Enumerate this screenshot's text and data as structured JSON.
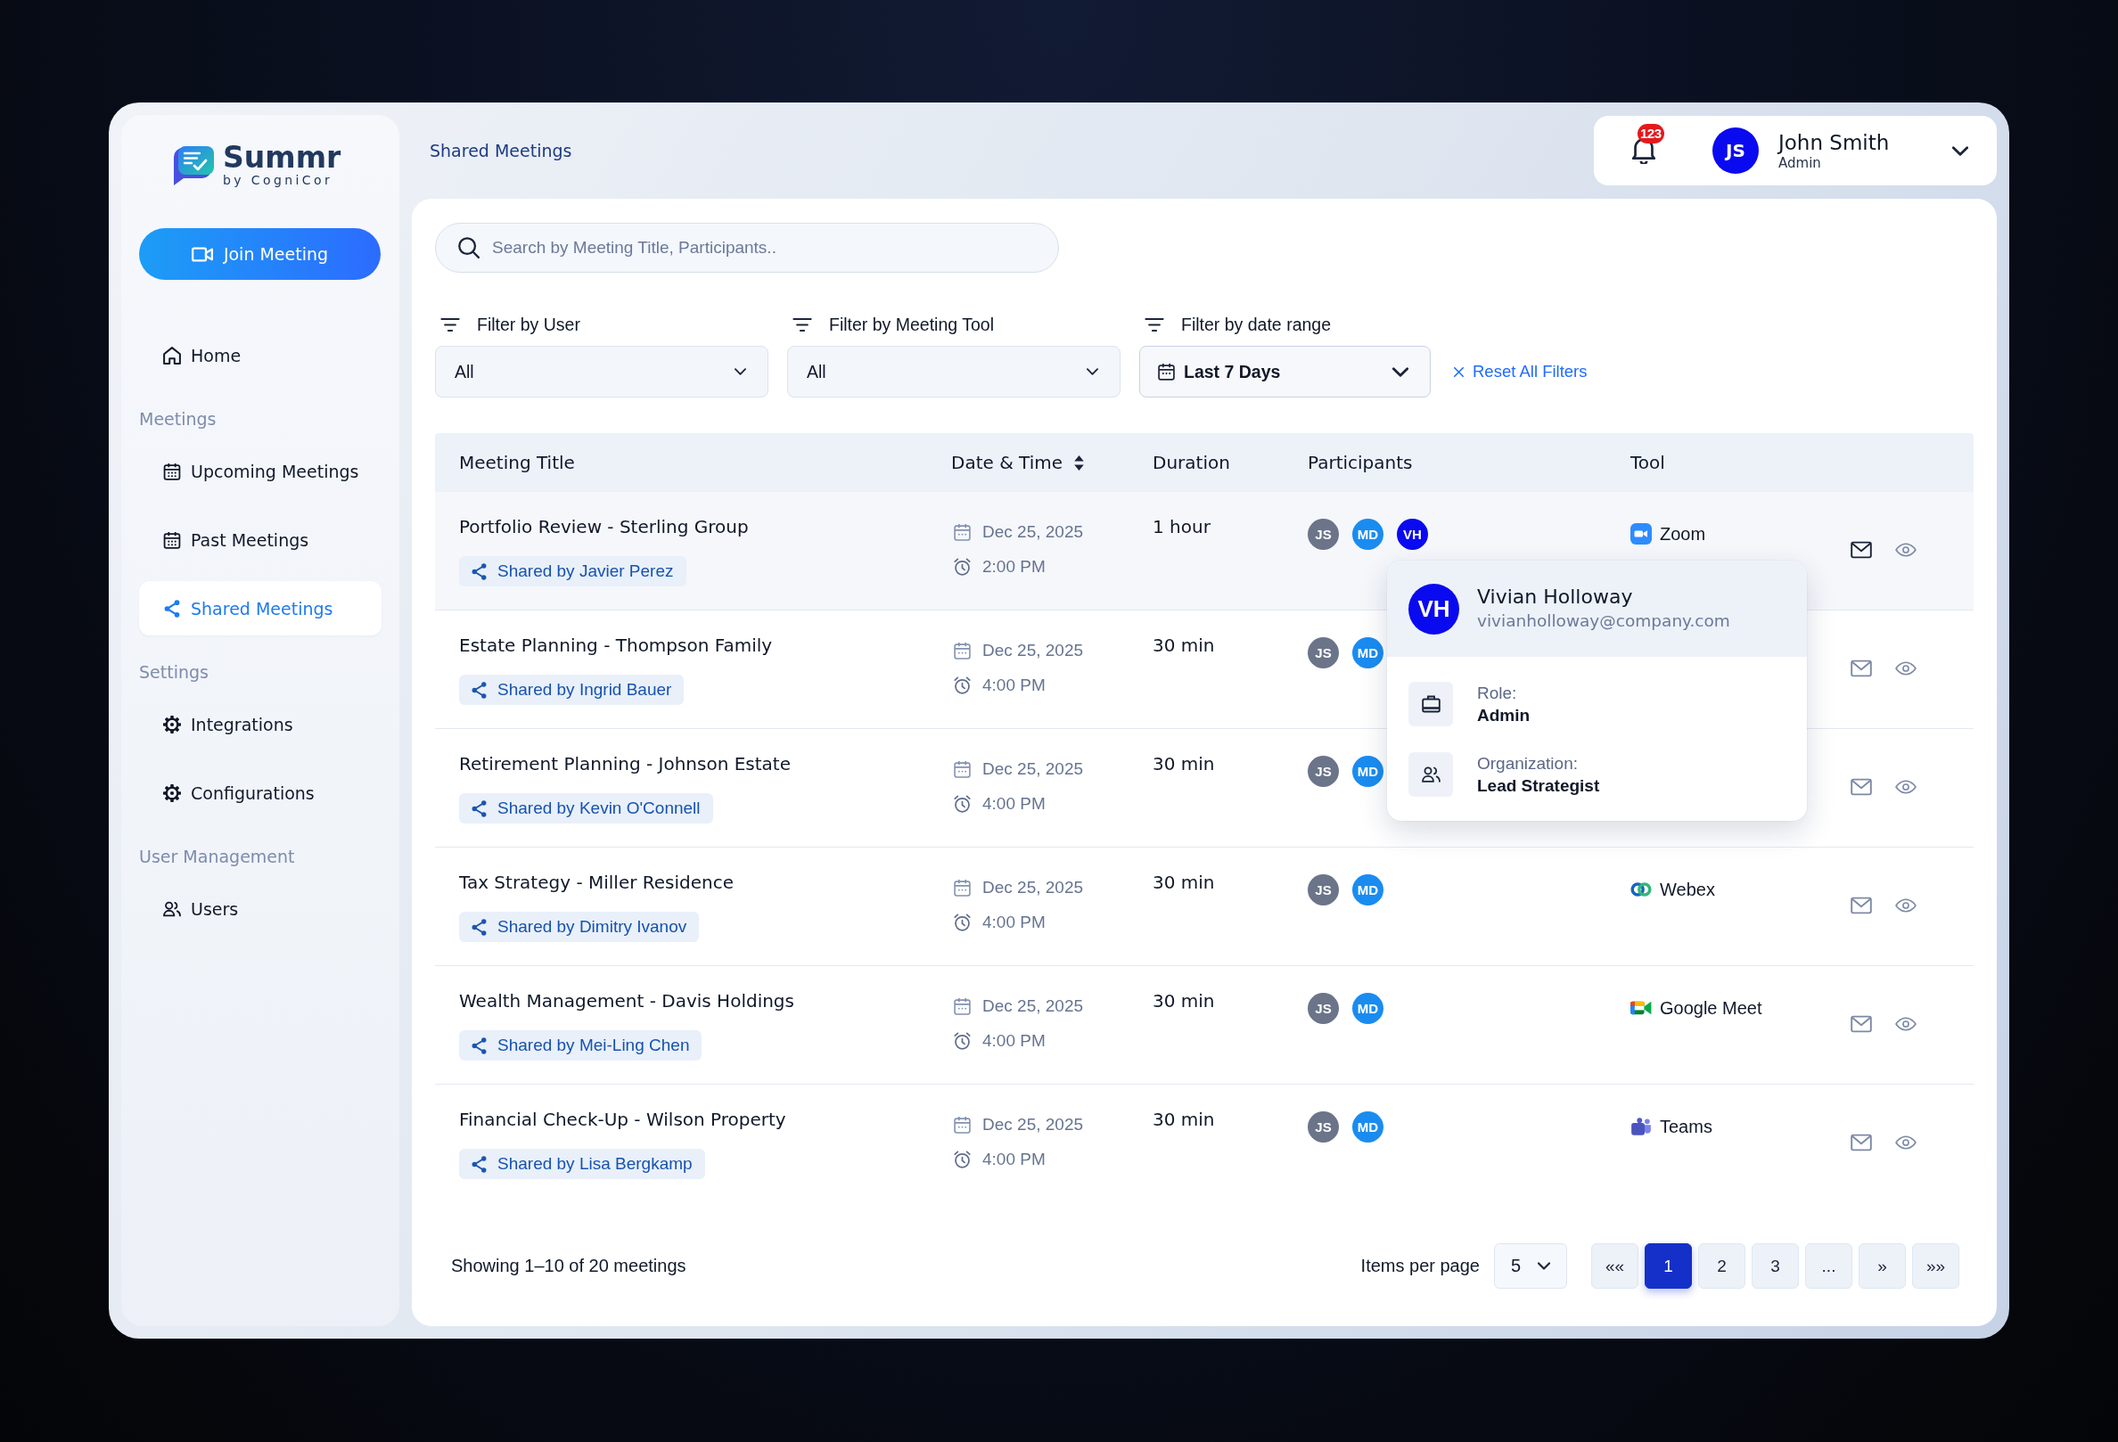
{
  "sidebar": {
    "logo": {
      "name": "Summr",
      "tagline": "by CogniCor"
    },
    "join_button": {
      "label": "Join Meeting"
    },
    "sections": [
      {
        "items": [
          {
            "label": "Home",
            "kind": "home",
            "selected": false
          }
        ]
      },
      {
        "heading": "Meetings",
        "items": [
          {
            "label": "Upcoming Meetings",
            "kind": "calendar",
            "selected": false
          },
          {
            "label": "Past Meetings",
            "kind": "calendar",
            "selected": false
          },
          {
            "label": "Shared Meetings",
            "kind": "share",
            "selected": true
          }
        ]
      },
      {
        "heading": "Settings",
        "items": [
          {
            "label": "Integrations",
            "kind": "gear",
            "selected": false
          },
          {
            "label": "Configurations",
            "kind": "gear",
            "selected": false
          }
        ]
      },
      {
        "heading": "User Management",
        "items": [
          {
            "label": "Users",
            "kind": "users",
            "selected": false
          }
        ]
      }
    ]
  },
  "header": {
    "breadcrumb": "Shared Meetings",
    "notifications": {
      "count": "123"
    },
    "user": {
      "initials": "JS",
      "name": "John Smith",
      "role": "Admin"
    }
  },
  "search": {
    "placeholder": "Search by Meeting Title, Participants.."
  },
  "filters": [
    {
      "label": "Filter by User",
      "value": "All",
      "kind": "select"
    },
    {
      "label": "Filter by Meeting Tool",
      "value": "All",
      "kind": "select"
    },
    {
      "label": "Filter by date range",
      "value": "Last 7 Days",
      "kind": "date"
    }
  ],
  "reset_filters": {
    "label": "Reset All Filters"
  },
  "table": {
    "columns": [
      {
        "label": "Meeting Title",
        "sortable": false
      },
      {
        "label": "Date & Time",
        "sortable": true
      },
      {
        "label": "Duration",
        "sortable": false
      },
      {
        "label": "Participants",
        "sortable": false
      },
      {
        "label": "Tool",
        "sortable": false
      }
    ],
    "rows": [
      {
        "title": "Portfolio Review - Sterling Group",
        "shared_by": "Shared by Javier Perez",
        "date": "Dec 25, 2025",
        "time": "2:00 PM",
        "duration": "1 hour",
        "participants": [
          {
            "initials": "JS",
            "color": "#6b7489"
          },
          {
            "initials": "MD",
            "color": "#1a8cf0"
          },
          {
            "initials": "VH",
            "color": "#0a0af0"
          }
        ],
        "tool": {
          "name": "Zoom",
          "kind": "zoom"
        },
        "hovered": true
      },
      {
        "title": "Estate Planning - Thompson Family",
        "shared_by": "Shared by Ingrid Bauer",
        "date": "Dec 25, 2025",
        "time": "4:00 PM",
        "duration": "30 min",
        "participants": [
          {
            "initials": "JS",
            "color": "#6b7489"
          },
          {
            "initials": "MD",
            "color": "#1a8cf0"
          }
        ],
        "hovered": false
      },
      {
        "title": "Retirement Planning - Johnson Estate",
        "shared_by": "Shared by Kevin O'Connell",
        "date": "Dec 25, 2025",
        "time": "4:00 PM",
        "duration": "30 min",
        "participants": [
          {
            "initials": "JS",
            "color": "#6b7489"
          },
          {
            "initials": "MD",
            "color": "#1a8cf0"
          }
        ],
        "hovered": false
      },
      {
        "title": "Tax Strategy - Miller Residence",
        "shared_by": "Shared by Dimitry Ivanov",
        "date": "Dec 25, 2025",
        "time": "4:00 PM",
        "duration": "30 min",
        "participants": [
          {
            "initials": "JS",
            "color": "#6b7489"
          },
          {
            "initials": "MD",
            "color": "#1a8cf0"
          }
        ],
        "tool": {
          "name": "Webex",
          "kind": "webex"
        },
        "hovered": false
      },
      {
        "title": "Wealth Management - Davis Holdings",
        "shared_by": "Shared by Mei-Ling Chen",
        "date": "Dec 25, 2025",
        "time": "4:00 PM",
        "duration": "30 min",
        "participants": [
          {
            "initials": "JS",
            "color": "#6b7489"
          },
          {
            "initials": "MD",
            "color": "#1a8cf0"
          }
        ],
        "tool": {
          "name": "Google Meet",
          "kind": "googlemeet"
        },
        "hovered": false
      },
      {
        "title": "Financial Check-Up - Wilson Property",
        "shared_by": "Shared by Lisa Bergkamp",
        "date": "Dec 25, 2025",
        "time": "4:00 PM",
        "duration": "30 min",
        "participants": [
          {
            "initials": "JS",
            "color": "#6b7489"
          },
          {
            "initials": "MD",
            "color": "#1a8cf0"
          }
        ],
        "tool": {
          "name": "Teams",
          "kind": "teams"
        },
        "hovered": false
      }
    ],
    "participant_popup": {
      "initials": "VH",
      "name": "Vivian Holloway",
      "email": "vivianholloway@company.com",
      "details": [
        {
          "label": "Role:",
          "value": "Admin",
          "kind": "role"
        },
        {
          "label": "Organization:",
          "value": "Lead Strategist",
          "kind": "organization"
        }
      ]
    }
  },
  "footer": {
    "summary": "Showing 1–10 of 20 meetings",
    "items_per_page": {
      "label": "Items per page",
      "value": "5"
    },
    "pages": [
      {
        "label": "««",
        "selected": false
      },
      {
        "label": "1",
        "selected": true
      },
      {
        "label": "2",
        "selected": false
      },
      {
        "label": "3",
        "selected": false
      },
      {
        "label": "...",
        "selected": false
      },
      {
        "label": "»",
        "selected": false
      },
      {
        "label": "»»",
        "selected": false
      }
    ]
  }
}
